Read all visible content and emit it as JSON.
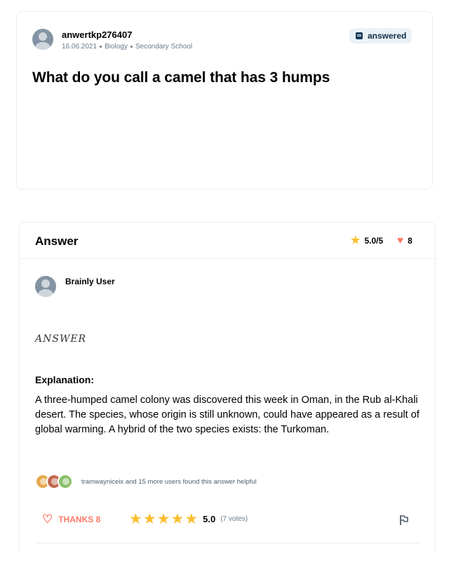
{
  "question": {
    "username": "anwertkp276407",
    "date": "16.06.2021",
    "subject": "Biology",
    "level": "Secondary School",
    "status_badge": "answered",
    "status_icon": "answered-icon",
    "title": "What do you call a camel that has 3 humps"
  },
  "answer": {
    "heading": "Answer",
    "rating": "5.0/5",
    "hearts": "8",
    "author": "Brainly User",
    "answer_word": "ANSWER",
    "explanation_label": "Explanation:",
    "explanation_text": "A three-humped camel colony was discovered this week in Oman, in the Rub al-Khali desert. The species, whose origin is still unknown, could have appeared as a result of global warming. A hybrid of the two species exists: the Turkoman.",
    "helpful_text": "tramwayniceix and 15 more users found this answer helpful",
    "thanks_label": "THANKS 8",
    "stars_value": 5,
    "score": "5.0",
    "votes": "(7 votes)"
  },
  "colors": {
    "accent_star": "#fbbe2e",
    "accent_heart": "#ff7968",
    "badge_bg": "#ebf2f7",
    "muted_text": "#687b8c"
  }
}
